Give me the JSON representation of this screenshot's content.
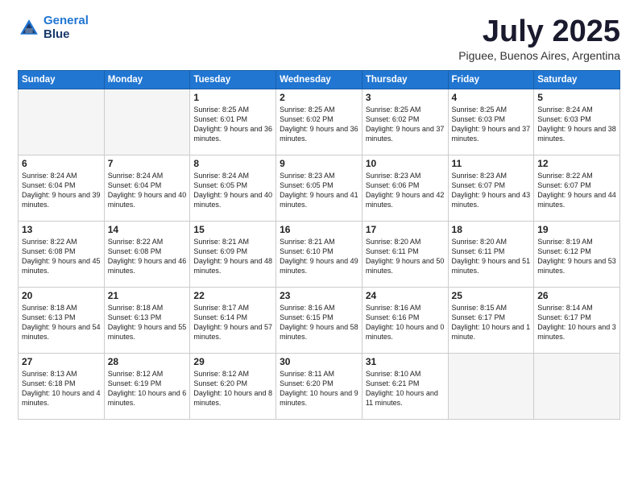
{
  "logo": {
    "line1": "General",
    "line2": "Blue"
  },
  "title": "July 2025",
  "subtitle": "Piguee, Buenos Aires, Argentina",
  "weekdays": [
    "Sunday",
    "Monday",
    "Tuesday",
    "Wednesday",
    "Thursday",
    "Friday",
    "Saturday"
  ],
  "weeks": [
    [
      {
        "day": "",
        "text": ""
      },
      {
        "day": "",
        "text": ""
      },
      {
        "day": "1",
        "text": "Sunrise: 8:25 AM\nSunset: 6:01 PM\nDaylight: 9 hours\nand 36 minutes."
      },
      {
        "day": "2",
        "text": "Sunrise: 8:25 AM\nSunset: 6:02 PM\nDaylight: 9 hours\nand 36 minutes."
      },
      {
        "day": "3",
        "text": "Sunrise: 8:25 AM\nSunset: 6:02 PM\nDaylight: 9 hours\nand 37 minutes."
      },
      {
        "day": "4",
        "text": "Sunrise: 8:25 AM\nSunset: 6:03 PM\nDaylight: 9 hours\nand 37 minutes."
      },
      {
        "day": "5",
        "text": "Sunrise: 8:24 AM\nSunset: 6:03 PM\nDaylight: 9 hours\nand 38 minutes."
      }
    ],
    [
      {
        "day": "6",
        "text": "Sunrise: 8:24 AM\nSunset: 6:04 PM\nDaylight: 9 hours\nand 39 minutes."
      },
      {
        "day": "7",
        "text": "Sunrise: 8:24 AM\nSunset: 6:04 PM\nDaylight: 9 hours\nand 40 minutes."
      },
      {
        "day": "8",
        "text": "Sunrise: 8:24 AM\nSunset: 6:05 PM\nDaylight: 9 hours\nand 40 minutes."
      },
      {
        "day": "9",
        "text": "Sunrise: 8:23 AM\nSunset: 6:05 PM\nDaylight: 9 hours\nand 41 minutes."
      },
      {
        "day": "10",
        "text": "Sunrise: 8:23 AM\nSunset: 6:06 PM\nDaylight: 9 hours\nand 42 minutes."
      },
      {
        "day": "11",
        "text": "Sunrise: 8:23 AM\nSunset: 6:07 PM\nDaylight: 9 hours\nand 43 minutes."
      },
      {
        "day": "12",
        "text": "Sunrise: 8:22 AM\nSunset: 6:07 PM\nDaylight: 9 hours\nand 44 minutes."
      }
    ],
    [
      {
        "day": "13",
        "text": "Sunrise: 8:22 AM\nSunset: 6:08 PM\nDaylight: 9 hours\nand 45 minutes."
      },
      {
        "day": "14",
        "text": "Sunrise: 8:22 AM\nSunset: 6:08 PM\nDaylight: 9 hours\nand 46 minutes."
      },
      {
        "day": "15",
        "text": "Sunrise: 8:21 AM\nSunset: 6:09 PM\nDaylight: 9 hours\nand 48 minutes."
      },
      {
        "day": "16",
        "text": "Sunrise: 8:21 AM\nSunset: 6:10 PM\nDaylight: 9 hours\nand 49 minutes."
      },
      {
        "day": "17",
        "text": "Sunrise: 8:20 AM\nSunset: 6:11 PM\nDaylight: 9 hours\nand 50 minutes."
      },
      {
        "day": "18",
        "text": "Sunrise: 8:20 AM\nSunset: 6:11 PM\nDaylight: 9 hours\nand 51 minutes."
      },
      {
        "day": "19",
        "text": "Sunrise: 8:19 AM\nSunset: 6:12 PM\nDaylight: 9 hours\nand 53 minutes."
      }
    ],
    [
      {
        "day": "20",
        "text": "Sunrise: 8:18 AM\nSunset: 6:13 PM\nDaylight: 9 hours\nand 54 minutes."
      },
      {
        "day": "21",
        "text": "Sunrise: 8:18 AM\nSunset: 6:13 PM\nDaylight: 9 hours\nand 55 minutes."
      },
      {
        "day": "22",
        "text": "Sunrise: 8:17 AM\nSunset: 6:14 PM\nDaylight: 9 hours\nand 57 minutes."
      },
      {
        "day": "23",
        "text": "Sunrise: 8:16 AM\nSunset: 6:15 PM\nDaylight: 9 hours\nand 58 minutes."
      },
      {
        "day": "24",
        "text": "Sunrise: 8:16 AM\nSunset: 6:16 PM\nDaylight: 10 hours\nand 0 minutes."
      },
      {
        "day": "25",
        "text": "Sunrise: 8:15 AM\nSunset: 6:17 PM\nDaylight: 10 hours\nand 1 minute."
      },
      {
        "day": "26",
        "text": "Sunrise: 8:14 AM\nSunset: 6:17 PM\nDaylight: 10 hours\nand 3 minutes."
      }
    ],
    [
      {
        "day": "27",
        "text": "Sunrise: 8:13 AM\nSunset: 6:18 PM\nDaylight: 10 hours\nand 4 minutes."
      },
      {
        "day": "28",
        "text": "Sunrise: 8:12 AM\nSunset: 6:19 PM\nDaylight: 10 hours\nand 6 minutes."
      },
      {
        "day": "29",
        "text": "Sunrise: 8:12 AM\nSunset: 6:20 PM\nDaylight: 10 hours\nand 8 minutes."
      },
      {
        "day": "30",
        "text": "Sunrise: 8:11 AM\nSunset: 6:20 PM\nDaylight: 10 hours\nand 9 minutes."
      },
      {
        "day": "31",
        "text": "Sunrise: 8:10 AM\nSunset: 6:21 PM\nDaylight: 10 hours\nand 11 minutes."
      },
      {
        "day": "",
        "text": ""
      },
      {
        "day": "",
        "text": ""
      }
    ]
  ]
}
